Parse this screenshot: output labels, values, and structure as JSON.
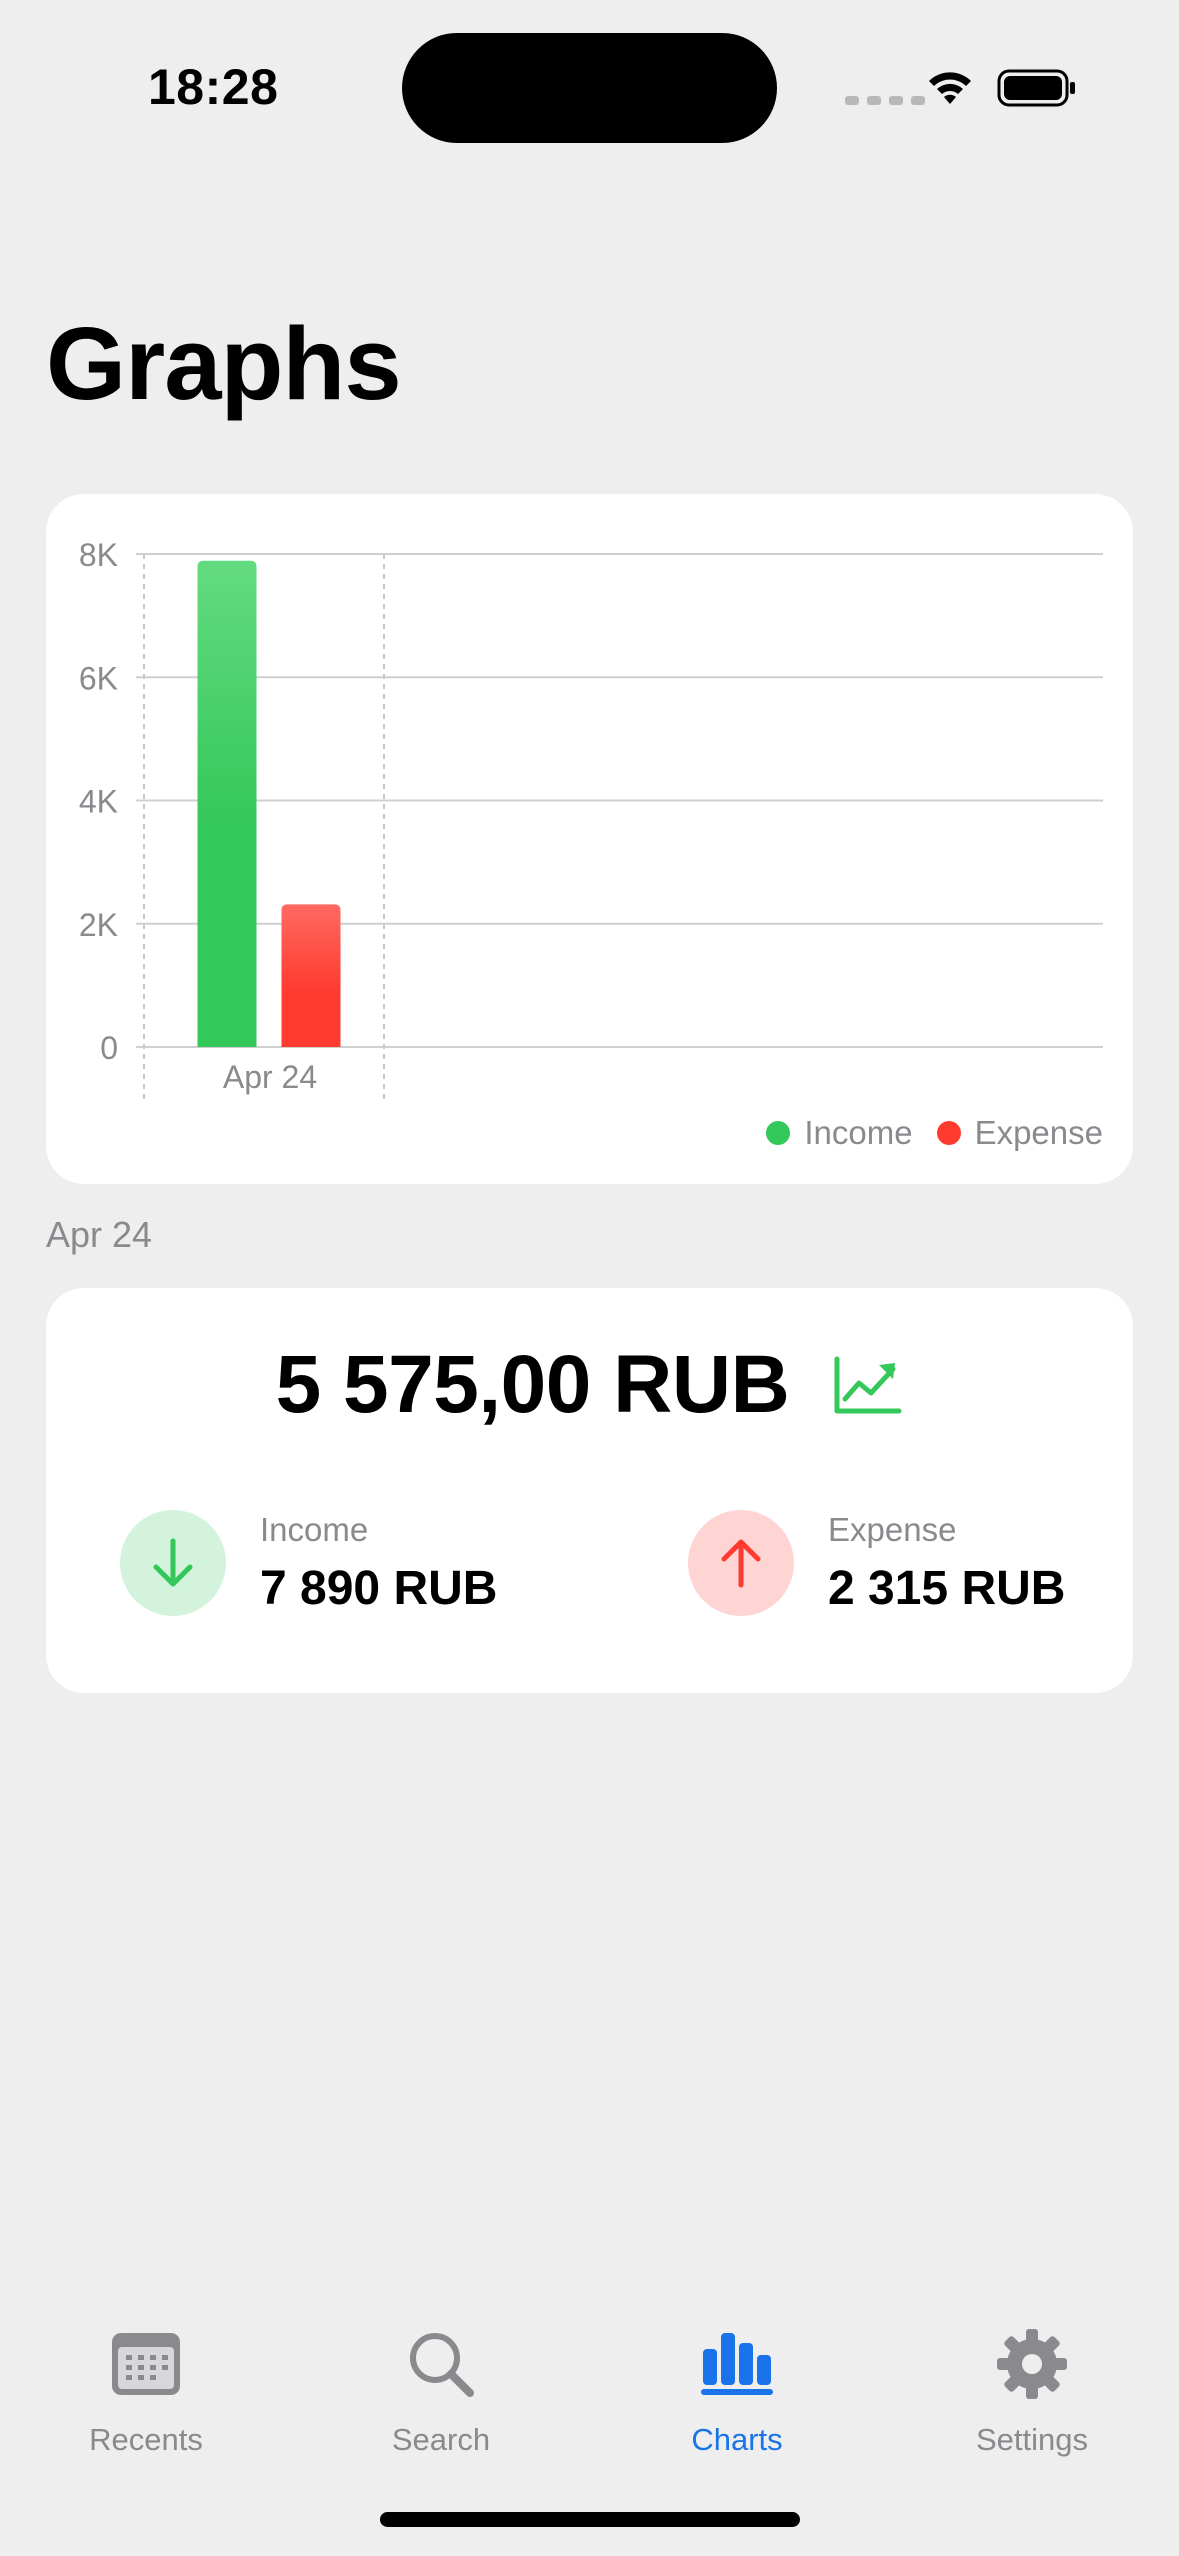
{
  "status_bar": {
    "time": "18:28"
  },
  "page": {
    "title": "Graphs"
  },
  "colors": {
    "background": "#eeeeee",
    "card": "#ffffff",
    "income": "#34c759",
    "expense": "#ff3b30",
    "income_bg": "#d4f3dc",
    "expense_bg": "#ffd5d3",
    "accent": "#1a73e8",
    "secondary_text": "#8a8a8e"
  },
  "chart_data": {
    "type": "bar",
    "categories": [
      "Apr 24"
    ],
    "series": [
      {
        "name": "Income",
        "values": [
          7890
        ],
        "color": "#34c759"
      },
      {
        "name": "Expense",
        "values": [
          2315
        ],
        "color": "#ff3b30"
      }
    ],
    "ylim": [
      0,
      8000
    ],
    "yticks": [
      0,
      2000,
      4000,
      6000,
      8000
    ],
    "ytick_labels": [
      "0",
      "2K",
      "4K",
      "6K",
      "8K"
    ],
    "grid": true,
    "legend_position": "bottom-right"
  },
  "legend": {
    "income": "Income",
    "expense": "Expense"
  },
  "period": {
    "label": "Apr 24"
  },
  "summary": {
    "total": "5 575,00 RUB",
    "trend_icon": "chart-line-uptrend-icon",
    "income_label": "Income",
    "income_value": "7 890 RUB",
    "income_icon": "arrow-down-icon",
    "expense_label": "Expense",
    "expense_value": "2 315 RUB",
    "expense_icon": "arrow-up-icon"
  },
  "tab_bar": {
    "tabs": [
      {
        "label": "Recents",
        "icon": "calendar-icon",
        "active": false
      },
      {
        "label": "Search",
        "icon": "magnifier-icon",
        "active": false
      },
      {
        "label": "Charts",
        "icon": "bar-chart-icon",
        "active": true
      },
      {
        "label": "Settings",
        "icon": "gear-icon",
        "active": false
      }
    ]
  }
}
